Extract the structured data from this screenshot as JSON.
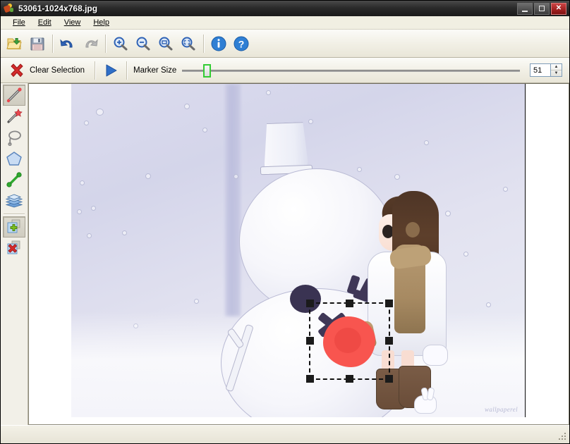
{
  "window": {
    "title": "53061-1024x768.jpg",
    "icon": "image-file-icon",
    "minimize_label": "Minimize",
    "maximize_label": "Maximize",
    "close_label": "Close"
  },
  "menubar": {
    "items": [
      {
        "label": "File",
        "mnemonic": "F"
      },
      {
        "label": "Edit",
        "mnemonic": "E"
      },
      {
        "label": "View",
        "mnemonic": "V"
      },
      {
        "label": "Help",
        "mnemonic": "H"
      }
    ]
  },
  "toolbar": {
    "buttons": [
      {
        "name": "open-file-button",
        "icon": "open-folder-icon",
        "label": "Open"
      },
      {
        "name": "save-file-button",
        "icon": "floppy-disk-icon",
        "label": "Save"
      },
      {
        "name": "undo-button",
        "icon": "undo-arrow-icon",
        "label": "Undo"
      },
      {
        "name": "redo-button",
        "icon": "redo-arrow-icon",
        "label": "Redo"
      },
      {
        "name": "zoom-in-button",
        "icon": "magnifier-plus-icon",
        "label": "Zoom In"
      },
      {
        "name": "zoom-out-button",
        "icon": "magnifier-minus-icon",
        "label": "Zoom Out"
      },
      {
        "name": "zoom-actual-button",
        "icon": "magnifier-actual-size-icon",
        "label": "Actual Size"
      },
      {
        "name": "zoom-fit-button",
        "icon": "magnifier-fit-icon",
        "label": "Fit to Window"
      },
      {
        "name": "info-button",
        "icon": "info-circle-icon",
        "label": "Info"
      },
      {
        "name": "help-button",
        "icon": "question-circle-icon",
        "label": "Help"
      }
    ]
  },
  "toolbar2": {
    "clear_selection_label": "Clear Selection",
    "clear_selection_icon": "red-x-icon",
    "run_icon": "blue-play-triangle-icon",
    "marker_size_label": "Marker Size",
    "marker_size_value": "51",
    "slider_min": "1",
    "slider_max": "100",
    "spin_up_glyph": "▲",
    "spin_down_glyph": "▼"
  },
  "lefttools": {
    "items": [
      {
        "name": "tool-marker-pen",
        "icon": "pen-marker-icon",
        "label": "Marker Pen",
        "selected": true
      },
      {
        "name": "tool-magic-wand",
        "icon": "magic-wand-icon",
        "label": "Magic Wand",
        "selected": false
      },
      {
        "name": "tool-lasso",
        "icon": "lasso-icon",
        "label": "Lasso",
        "selected": false
      },
      {
        "name": "tool-polygon",
        "icon": "polygon-icon",
        "label": "Polygon",
        "selected": false
      },
      {
        "name": "tool-line",
        "icon": "line-icon",
        "label": "Line",
        "selected": false
      },
      {
        "name": "tool-layers",
        "icon": "layers-stack-icon",
        "label": "Layers",
        "selected": false
      },
      {
        "name": "tool-add-page",
        "icon": "add-page-plus-icon",
        "label": "Add Page",
        "selected": true
      },
      {
        "name": "tool-delete-page",
        "icon": "delete-page-x-icon",
        "label": "Delete Page",
        "selected": false
      }
    ]
  },
  "canvas": {
    "image_name": "53061-1024x768.jpg",
    "image_description": "Snowy winter illustration: a snowman with a bucket hat and a girl in a white coat with a tan scarf and brown boots",
    "watermark": "wallpaperel",
    "selection": {
      "label": "marker-selection",
      "marker_color": "#f8554f",
      "marker_inner_color": "#ef4a45",
      "handle_color": "#1b1b1b",
      "handle_count": "8"
    },
    "snowman": {
      "hat_label": "bucket-hat",
      "eye_color": "#3a3352",
      "mark_color": "#3f3757"
    },
    "girl": {
      "hair_color": "#4e3526",
      "scarf_color": "#b79a72",
      "boot_color": "#7a5c46",
      "coat_color": "#ffffff"
    }
  },
  "statusbar": {
    "text": ""
  },
  "colors": {
    "title_bar": "#2b2b2b",
    "close_button": "#a02020",
    "accent_blue": "#1f6fc4",
    "slider_green": "#33cc33",
    "toolbar_bg": "#f2f0e6"
  }
}
